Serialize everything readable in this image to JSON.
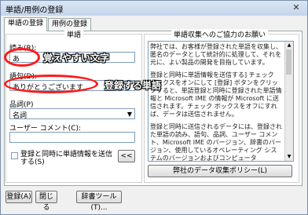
{
  "window": {
    "title": "単語/用例の登録",
    "close_glyph": "✕"
  },
  "tabs": [
    {
      "label": "単語の登録",
      "active": true
    },
    {
      "label": "用例の登録",
      "active": false
    }
  ],
  "word_group": {
    "legend": "単語",
    "reading_label": "読み(R):",
    "reading_value": "あ",
    "word_label": "語句(D):",
    "word_value": "ありがとうございます",
    "pos_label": "品詞(P)",
    "pos_value": "名詞",
    "comment_label": "ユーザー コメント(C):",
    "comment_value": "",
    "send_checkbox_label": "登録と同時に単語情報を送信する(S)",
    "send_checked": false,
    "collapse_button": "<<"
  },
  "annotations": {
    "reading_note": "覚えやすい文字",
    "word_note": "登録する単語",
    "accent": "#ff1a1a"
  },
  "policy_group": {
    "legend": "単語収集へのご協力のお願い",
    "paragraphs": [
      "弊社では、お客様が登録された単語を収集し、匿名のデータとして統計的に処理して、それを元に、よい製品の開発を目指しています。",
      "登録と同時に単語情報を送信する] チェック ボックスをオンにして [登録] ボタンをクリックすると、単語登録と同時に登録された単語情報と Microsoft IME の情報が Microsoft に送信されます。チェック ボックスをオフにすれば、データは送信されません。",
      "登録と同時に送信されるデータには、登録された単語の読み、語句、品詞、ユーザー コメント、Microsoft IME のバージョン、辞書のバージョン、使用しているオペレーティング システムのバージョンおよびコンピュータ"
    ],
    "policy_button": "弊社のデータ収集ポリシー(L)"
  },
  "footer": {
    "register_button": "登録(A)",
    "close_button": "閉じる",
    "dict_tool_button": "辞書ツール(T)..."
  }
}
